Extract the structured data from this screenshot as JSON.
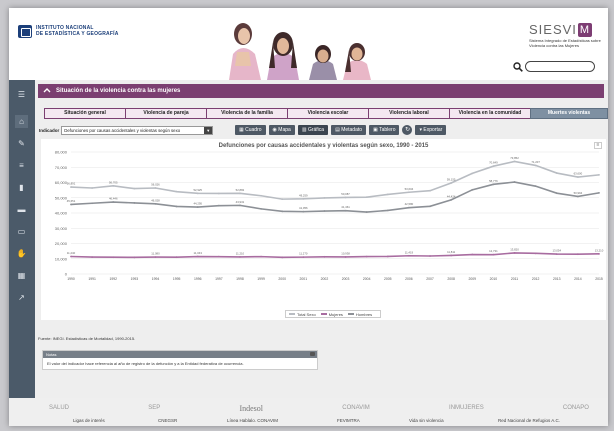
{
  "header": {
    "inegi_line1": "INSTITUTO NACIONAL",
    "inegi_line2": "DE ESTADÍSTICA Y GEOGRAFÍA",
    "siesvi_title": "SIESVI",
    "siesvi_badge": "M",
    "siesvi_subtitle": "Sistema Integrado de Estadísticas sobre Violencia contra las Mujeres",
    "search_placeholder": ""
  },
  "sidebar": {
    "icons": [
      "menu-icon",
      "home-icon",
      "edit-icon",
      "list-icon",
      "document-icon",
      "presentation-icon",
      "screen-icon",
      "handshake-icon",
      "table-icon",
      "chart-icon"
    ]
  },
  "main": {
    "title": "Situación de la violencia contra las mujeres",
    "tabs": [
      {
        "label": "Situación general",
        "active": false
      },
      {
        "label": "Violencia de pareja",
        "active": false
      },
      {
        "label": "Violencia de la familia",
        "active": false
      },
      {
        "label": "Violencia escolar",
        "active": false
      },
      {
        "label": "Violencia laboral",
        "active": false
      },
      {
        "label": "Violencia en la comunidad",
        "active": false
      },
      {
        "label": "Muertes violentas",
        "active": true
      }
    ],
    "indicator_label": "Indicador",
    "indicator_value": "Defunciones por causas accidentales y violentas según sexo",
    "toolbar": {
      "cuadro": "Cuadro",
      "mapa": "Mapa",
      "grafica": "Gráfica",
      "metadato": "Metadato",
      "tablero": "Tablero",
      "exportar": "Exportar"
    },
    "source": "Fuente: INEGI. Estadísticas de Mortalidad, 1990-2015.",
    "notes_title": "Notas",
    "notes_text": "El valor del indicador hace referencia al año de registro de la defunción y a la Entidad federativa de ocurrencia."
  },
  "chart_data": {
    "type": "line",
    "title": "Defunciones por causas accidentales y violentas según sexo, 1990 - 2015",
    "x": [
      "1990",
      "1991",
      "1992",
      "1993",
      "1994",
      "1995",
      "1996",
      "1997",
      "1998",
      "1999",
      "2000",
      "2001",
      "2002",
      "2003",
      "2004",
      "2005",
      "2006",
      "2007",
      "2008",
      "2009",
      "2010",
      "2011",
      "2012",
      "2013",
      "2014",
      "2015"
    ],
    "ylim": [
      0,
      80000
    ],
    "yticks": [
      "0",
      "10,000",
      "20,000",
      "30,000",
      "40,000",
      "50,000",
      "60,000",
      "70,000",
      "80,000"
    ],
    "series": [
      {
        "name": "Total Sexo",
        "color": "#b8bcc2",
        "values": [
          57000,
          56400,
          57800,
          56000,
          56400,
          54000,
          52900,
          52800,
          52900,
          51300,
          49100,
          49300,
          49900,
          50200,
          50400,
          52200,
          53600,
          54600,
          59700,
          66000,
          70700,
          73800,
          71200,
          66200,
          63600,
          65000
        ]
      },
      {
        "name": "Hombres",
        "color": "#8c9096",
        "values": [
          45600,
          46400,
          47200,
          46600,
          46000,
          44300,
          43900,
          44800,
          45000,
          42700,
          41100,
          40900,
          41300,
          41500,
          40600,
          41700,
          43500,
          44400,
          48600,
          55200,
          58800,
          60300,
          57600,
          53000,
          50900,
          53200
        ]
      },
      {
        "name": "Mujeres",
        "color": "#a86ca0",
        "values": [
          11470,
          11090,
          11000,
          10940,
          11080,
          11040,
          11460,
          11370,
          11210,
          11390,
          10940,
          11060,
          11270,
          11180,
          11410,
          11510,
          11960,
          11810,
          12160,
          12730,
          12680,
          13820,
          13540,
          13050,
          12980,
          13210
        ]
      }
    ],
    "data_labels": {
      "Total Sexo": [
        "56,891",
        "",
        "56,705",
        "",
        "56,026",
        "",
        "52,925",
        "",
        "52,882",
        "",
        "",
        "49,259",
        "",
        "50,087",
        "",
        "",
        "53,604",
        "",
        "59,155",
        "",
        "70,649",
        "73,852",
        "71,207",
        "",
        "63,600",
        ""
      ],
      "Hombres": [
        "45,651",
        "",
        "46,446",
        "",
        "46,028",
        "",
        "44,295",
        "",
        "43,931",
        "",
        "",
        "41,056",
        "",
        "41,461",
        "",
        "",
        "42,580",
        "",
        "44,424",
        "",
        "58,776",
        "",
        "",
        "",
        "50,994",
        ""
      ],
      "Mujeres": [
        "11,240",
        "",
        "",
        "",
        "11,080",
        "",
        "11,043",
        "",
        "11,210",
        "",
        "",
        "11,270",
        "",
        "10,938",
        "",
        "",
        "11,419",
        "",
        "11,811",
        "",
        "12,731",
        "13,820",
        "",
        "13,054",
        "",
        "13,210"
      ]
    },
    "legend": "bottom-center"
  },
  "footer": {
    "logos": [
      "SALUD",
      "SEP",
      "Indesol",
      "CONAVIM",
      "INMUJERES",
      "CONAPO"
    ],
    "links": [
      "Ligas de interés",
      "CNEGSR",
      "Línea Hablalo. CONAVIM",
      "FEVIMTRA",
      "Vida sin violencia",
      "Red Nacional de Refugios A.C."
    ]
  }
}
